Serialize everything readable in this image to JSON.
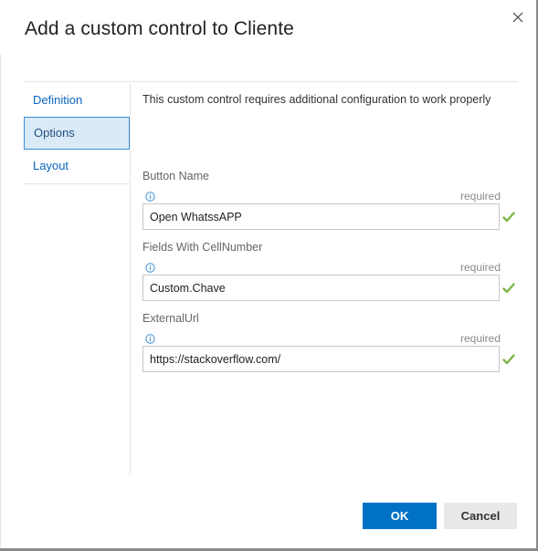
{
  "dialog": {
    "title": "Add a custom control to Cliente",
    "close_icon": "close-icon"
  },
  "nav": {
    "items": [
      {
        "label": "Definition",
        "selected": false
      },
      {
        "label": "Options",
        "selected": true
      },
      {
        "label": "Layout",
        "selected": false
      }
    ]
  },
  "options": {
    "notice": "This custom control requires additional configuration to work properly",
    "fields": [
      {
        "label": "Button Name",
        "required_text": "required",
        "value": "Open WhatssAPP",
        "status": "valid"
      },
      {
        "label": "Fields With CellNumber",
        "required_text": "required",
        "value": "Custom.Chave",
        "status": "valid"
      },
      {
        "label": "ExternalUrl",
        "required_text": "required",
        "value": "https://stackoverflow.com/",
        "status": "valid"
      }
    ]
  },
  "footer": {
    "ok_label": "OK",
    "cancel_label": "Cancel"
  },
  "colors": {
    "accent": "#0072c6",
    "link": "#0b64c0",
    "selected_bg": "#dbeaf7",
    "valid_check": "#7ab648",
    "info_icon": "#3a8fd6"
  }
}
